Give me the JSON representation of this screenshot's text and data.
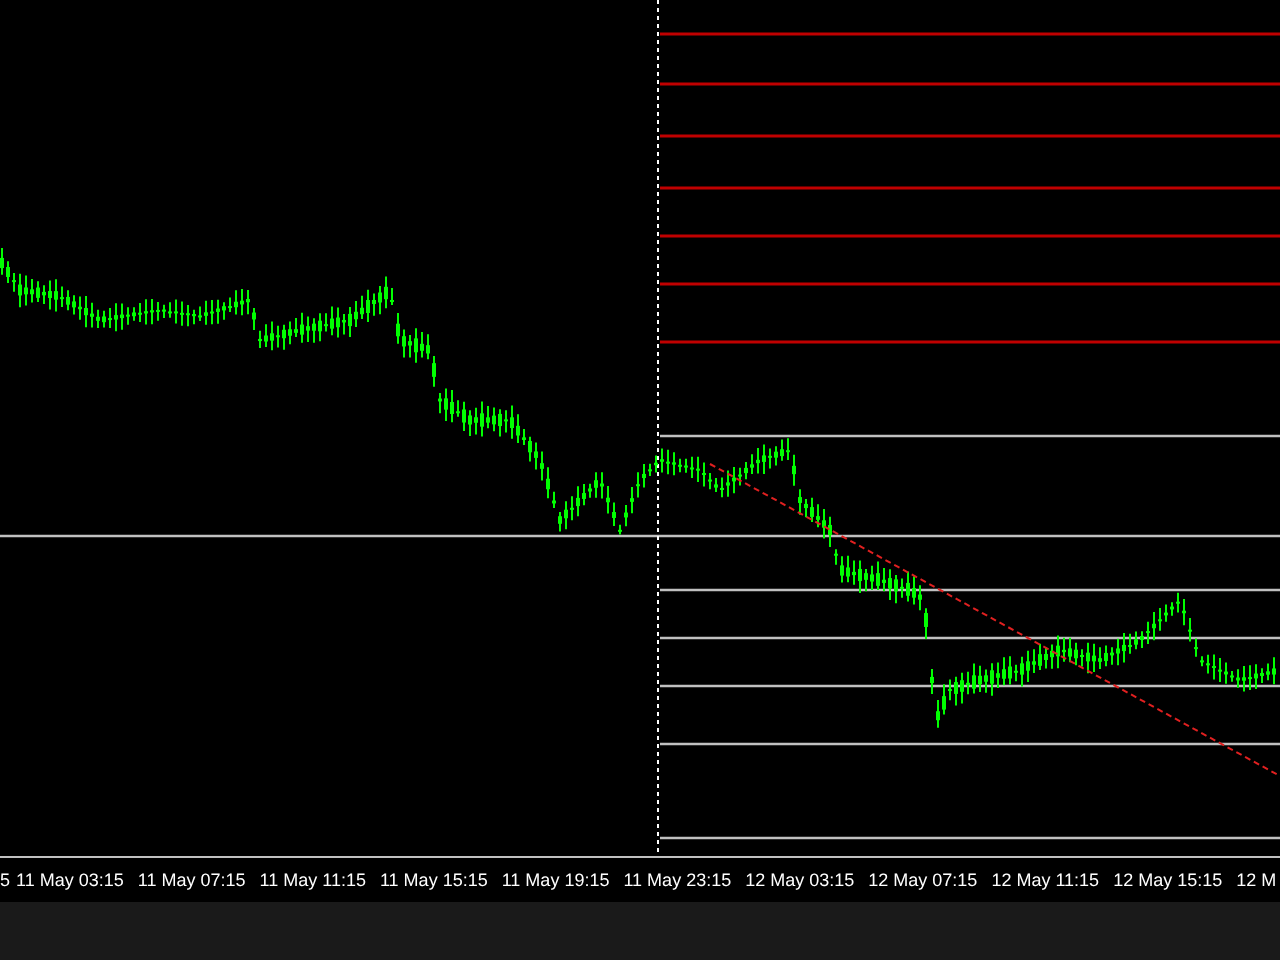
{
  "chart": {
    "time_axis_labels": [
      "5",
      "11 May 03:15",
      "11 May 07:15",
      "11 May 11:15",
      "11 May 15:15",
      "11 May 19:15",
      "11 May 23:15",
      "12 May 03:15",
      "12 May 07:15",
      "12 May 11:15",
      "12 May 15:15",
      "12 M"
    ]
  }
}
